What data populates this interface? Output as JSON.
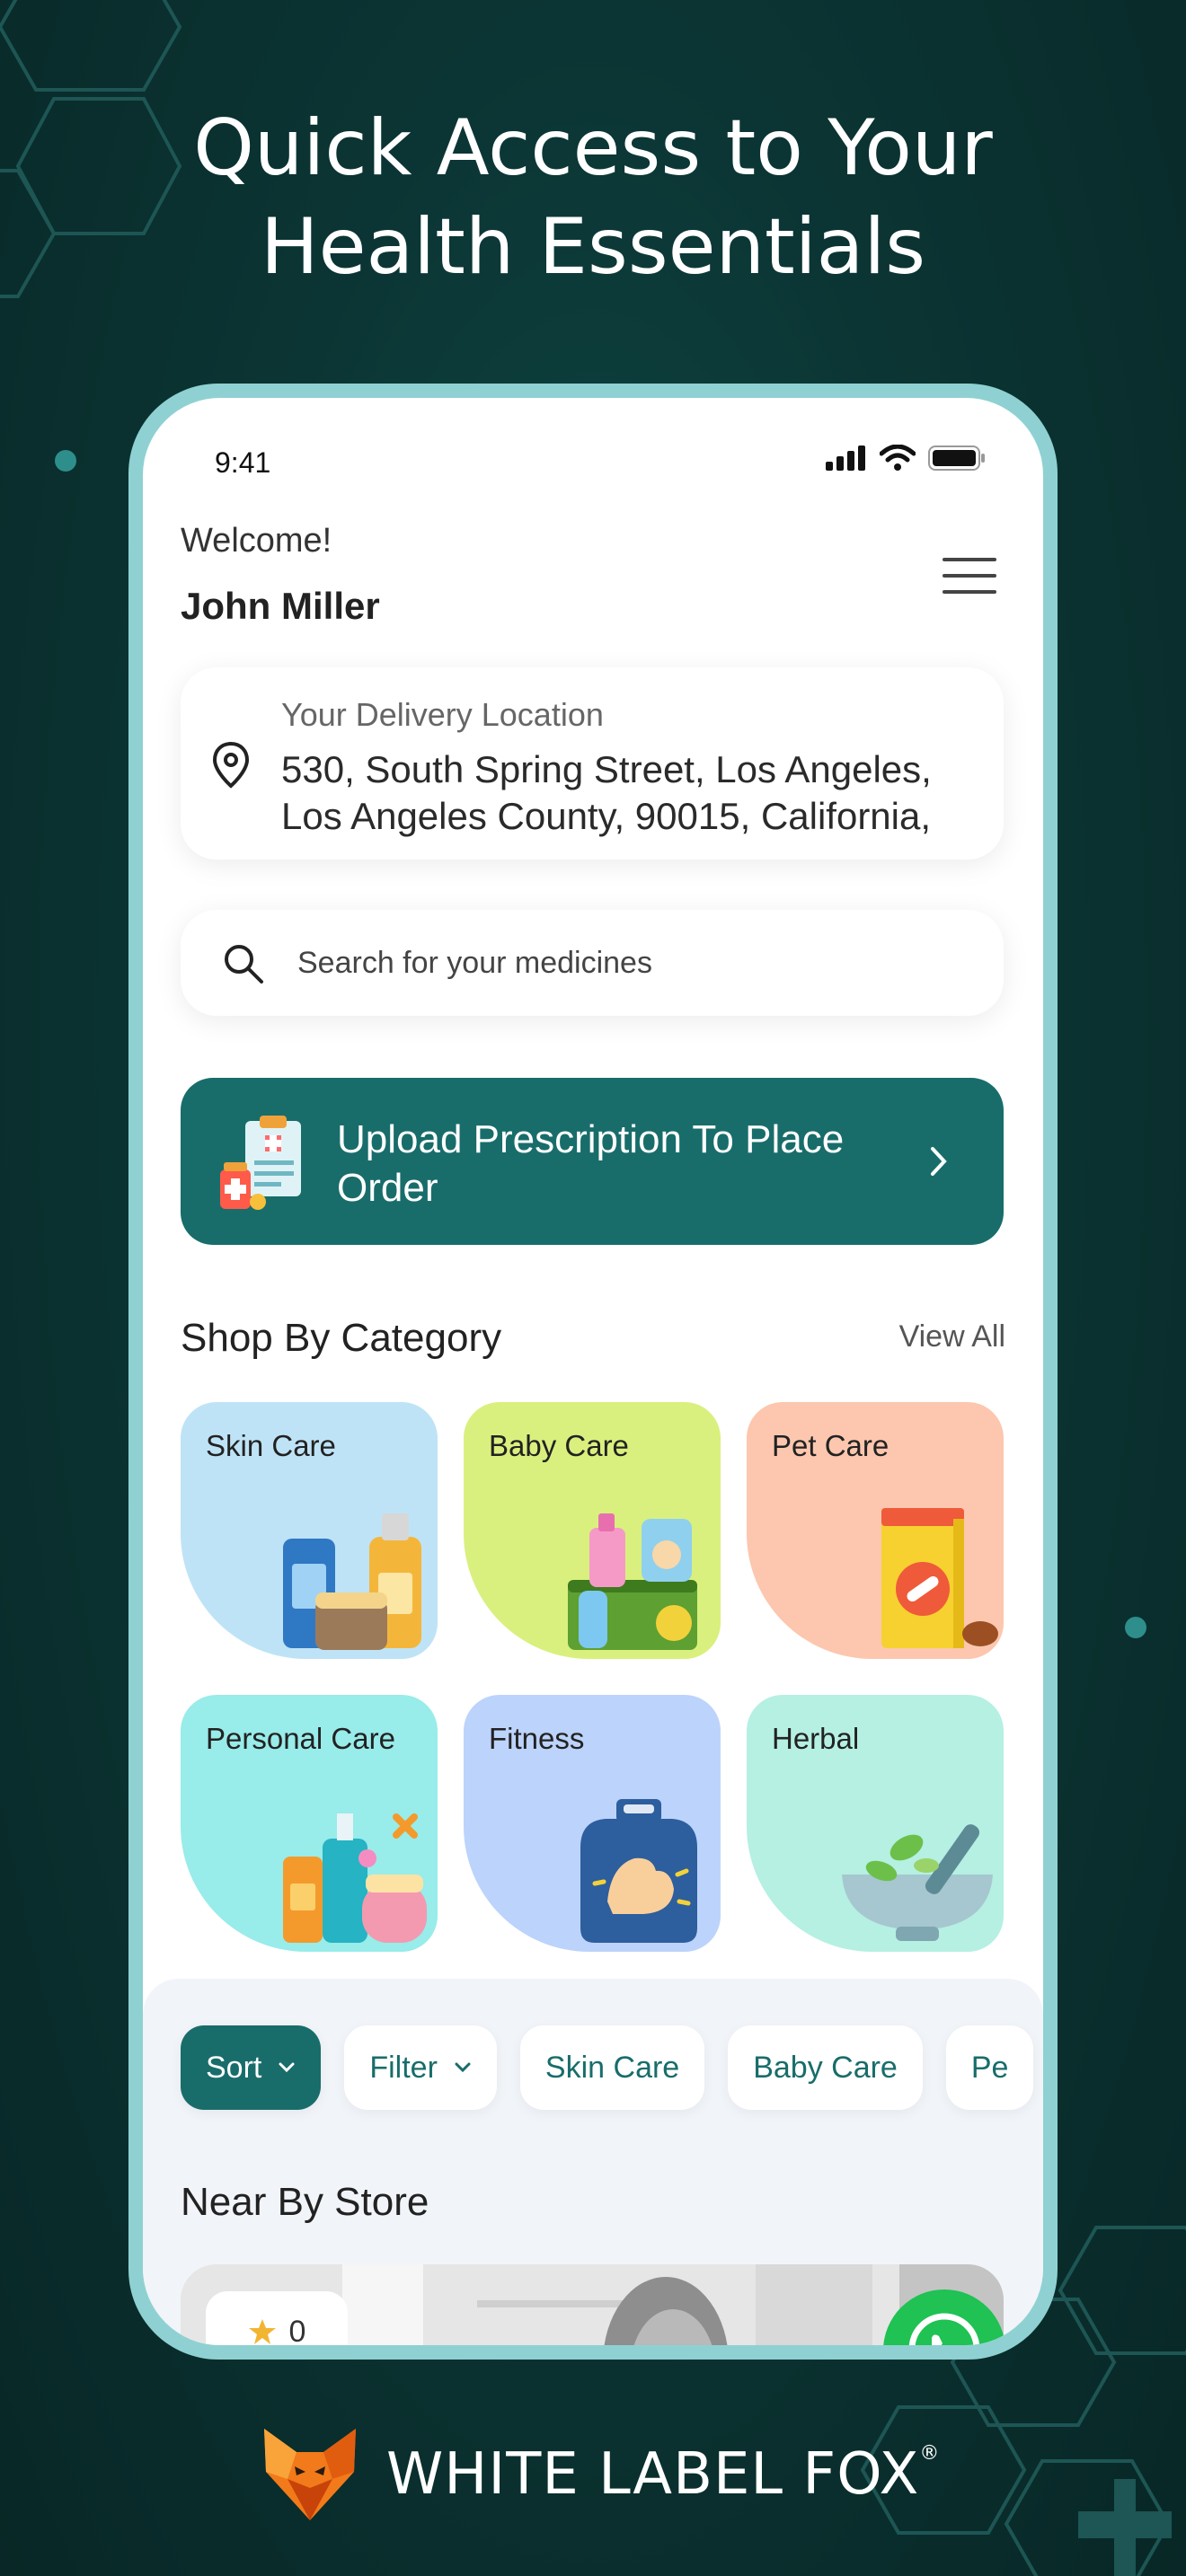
{
  "headline": {
    "line1": "Quick Access to Your",
    "line2": "Health Essentials"
  },
  "status_bar": {
    "time": "9:41",
    "icons": [
      "signal-icon",
      "wifi-icon",
      "battery-icon"
    ]
  },
  "header": {
    "greeting": "Welcome!",
    "user_name": "John Miller",
    "menu_icon": "hamburger-menu-icon"
  },
  "delivery": {
    "label": "Your Delivery Location",
    "address_line1": "530, South Spring Street, Los Angeles,",
    "address_line2": "Los Angeles County, 90015, California,",
    "icon": "location-pin-icon"
  },
  "search": {
    "placeholder": "Search for your medicines",
    "icon": "search-icon"
  },
  "upload_banner": {
    "line1": "Upload Prescription To Place",
    "line2": "Order",
    "icon": "chevron-right-icon"
  },
  "categories_section": {
    "title": "Shop By Category",
    "view_all": "View All",
    "items": [
      {
        "label": "Skin Care",
        "color": "#bfe3f6"
      },
      {
        "label": "Baby Care",
        "color": "#d9f07e"
      },
      {
        "label": "Pet Care",
        "color": "#fcc7ae"
      },
      {
        "label": "Personal Care",
        "color": "#98ecea"
      },
      {
        "label": "Fitness",
        "color": "#bcd3fb"
      },
      {
        "label": "Herbal",
        "color": "#b5f0e2"
      }
    ]
  },
  "filters": {
    "sort": "Sort",
    "filter": "Filter",
    "chips": [
      "Skin Care",
      "Baby Care",
      "Pe"
    ]
  },
  "nearby": {
    "title": "Near By Store",
    "rating": "0"
  },
  "brand": {
    "name": "WHITE LABEL FOX",
    "mark": "®"
  },
  "colors": {
    "primary": "#186d6b",
    "background": "#0b3534",
    "whatsapp": "#1fc253"
  }
}
